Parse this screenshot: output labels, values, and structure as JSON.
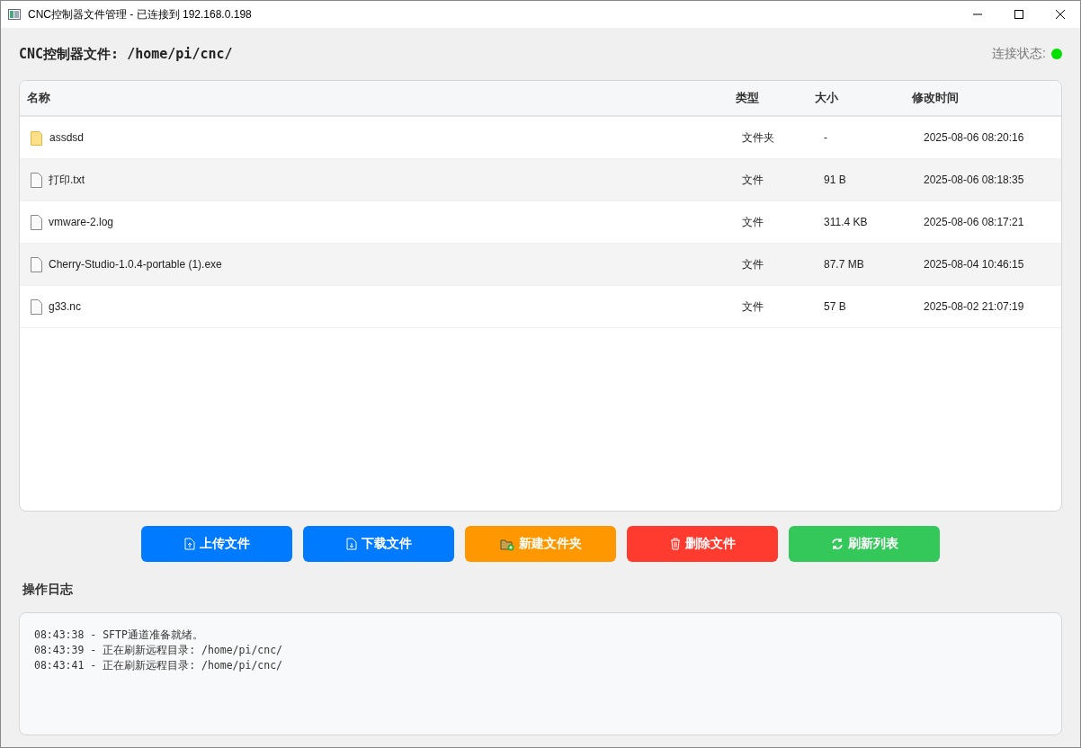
{
  "window": {
    "title": "CNC控制器文件管理 - 已连接到 192.168.0.198"
  },
  "header": {
    "path_label": "CNC控制器文件: /home/pi/cnc/",
    "status_label": "连接状态:",
    "connected": true
  },
  "table": {
    "columns": [
      "名称",
      "类型",
      "大小",
      "修改时间"
    ],
    "rows": [
      {
        "kind": "folder",
        "name": "assdsd",
        "type": "文件夹",
        "size": "-",
        "modified": "2025-08-06 08:20:16"
      },
      {
        "kind": "file",
        "name": "打印.txt",
        "type": "文件",
        "size": "91 B",
        "modified": "2025-08-06 08:18:35"
      },
      {
        "kind": "file",
        "name": "vmware-2.log",
        "type": "文件",
        "size": "311.4 KB",
        "modified": "2025-08-06 08:17:21"
      },
      {
        "kind": "file",
        "name": "Cherry-Studio-1.0.4-portable (1).exe",
        "type": "文件",
        "size": "87.7 MB",
        "modified": "2025-08-04 10:46:15"
      },
      {
        "kind": "file",
        "name": "g33.nc",
        "type": "文件",
        "size": "57 B",
        "modified": "2025-08-02 21:07:19"
      }
    ]
  },
  "buttons": [
    {
      "kind": "upload",
      "label": "上传文件",
      "color": "#007bff"
    },
    {
      "kind": "download",
      "label": "下载文件",
      "color": "#007bff"
    },
    {
      "kind": "new-folder",
      "label": "新建文件夹",
      "color": "#ff9800"
    },
    {
      "kind": "delete",
      "label": "删除文件",
      "color": "#ff3b30"
    },
    {
      "kind": "refresh",
      "label": "刷新列表",
      "color": "#34c759"
    }
  ],
  "log": {
    "title": "操作日志",
    "lines": [
      "08:43:38 - SFTP通道准备就绪。",
      "08:43:39 - 正在刷新远程目录: /home/pi/cnc/",
      "08:43:41 - 正在刷新远程目录: /home/pi/cnc/"
    ]
  }
}
